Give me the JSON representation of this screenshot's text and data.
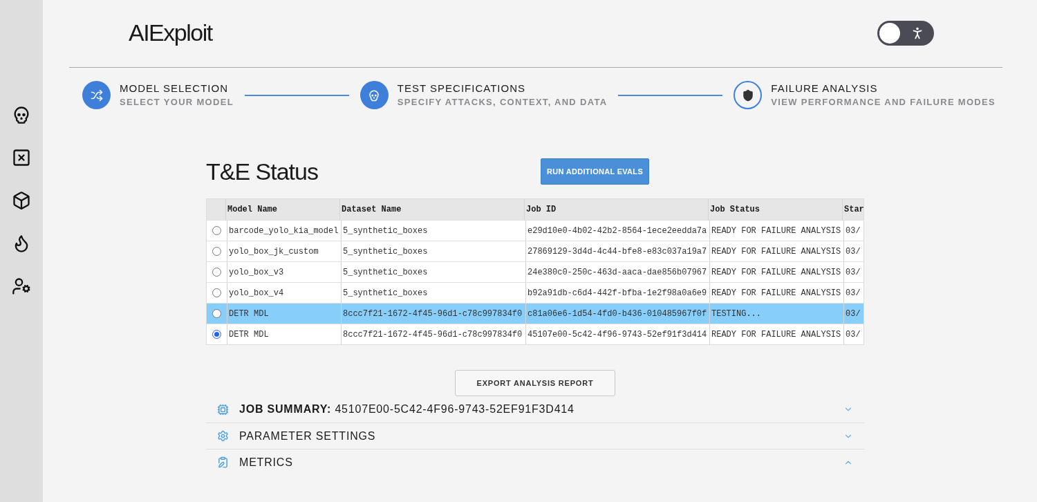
{
  "app": {
    "logo": "AIExploit"
  },
  "mode_toggle": {
    "on": false
  },
  "steps": [
    {
      "title": "MODEL SELECTION",
      "subtitle": "SELECT YOUR MODEL",
      "completed": true
    },
    {
      "title": "TEST SPECIFICATIONS",
      "subtitle": "SPECIFY ATTACKS, CONTEXT, AND DATA",
      "completed": true
    },
    {
      "title": "FAILURE ANALYSIS",
      "subtitle": "VIEW PERFORMANCE AND FAILURE MODES",
      "completed": false
    }
  ],
  "status": {
    "title": "T&E Status",
    "run_button": "RUN ADDITIONAL EVALS"
  },
  "table": {
    "columns": [
      "Model Name",
      "Dataset Name",
      "Job ID",
      "Job Status",
      "Star"
    ],
    "rows": [
      {
        "selected": false,
        "highlighted": false,
        "cells": [
          "barcode_yolo_kia_model",
          "5_synthetic_boxes",
          "e29d10e0-4b02-42b2-8564-1ece2eedda7a",
          "READY FOR FAILURE ANALYSIS",
          "03/"
        ]
      },
      {
        "selected": false,
        "highlighted": false,
        "cells": [
          "yolo_box_jk_custom",
          "5_synthetic_boxes",
          "27869129-3d4d-4c44-bfe8-e83c037a19a7",
          "READY FOR FAILURE ANALYSIS",
          "03/"
        ]
      },
      {
        "selected": false,
        "highlighted": false,
        "cells": [
          "yolo_box_v3",
          "5_synthetic_boxes",
          "24e380c0-250c-463d-aaca-dae856b07967",
          "READY FOR FAILURE ANALYSIS",
          "03/"
        ]
      },
      {
        "selected": false,
        "highlighted": false,
        "cells": [
          "yolo_box_v4",
          "5_synthetic_boxes",
          "b92a91db-c6d4-442f-bfba-1e2f98a0a6e9",
          "READY FOR FAILURE ANALYSIS",
          "03/"
        ]
      },
      {
        "selected": false,
        "highlighted": true,
        "cells": [
          "DETR MDL",
          "8ccc7f21-1672-4f45-96d1-c78c997834f0",
          "c81a06e6-1d54-4fd0-b436-010485967f0f",
          "TESTING...",
          "03/"
        ]
      },
      {
        "selected": true,
        "highlighted": false,
        "cells": [
          "DETR MDL",
          "8ccc7f21-1672-4f45-96d1-c78c997834f0",
          "45107e00-5c42-4f96-9743-52ef91f3d414",
          "READY FOR FAILURE ANALYSIS",
          "03/"
        ]
      }
    ]
  },
  "export_button": "EXPORT ANALYSIS REPORT",
  "sections": [
    {
      "kind": "summary",
      "title": "**JOB SUMMARY:** 45107E00-5C42-4F96-9743-52EF91F3D414",
      "expanded": false
    },
    {
      "kind": "settings",
      "title": "PARAMETER SETTINGS",
      "expanded": false
    },
    {
      "kind": "metrics",
      "title": "METRICS",
      "expanded": true
    }
  ]
}
